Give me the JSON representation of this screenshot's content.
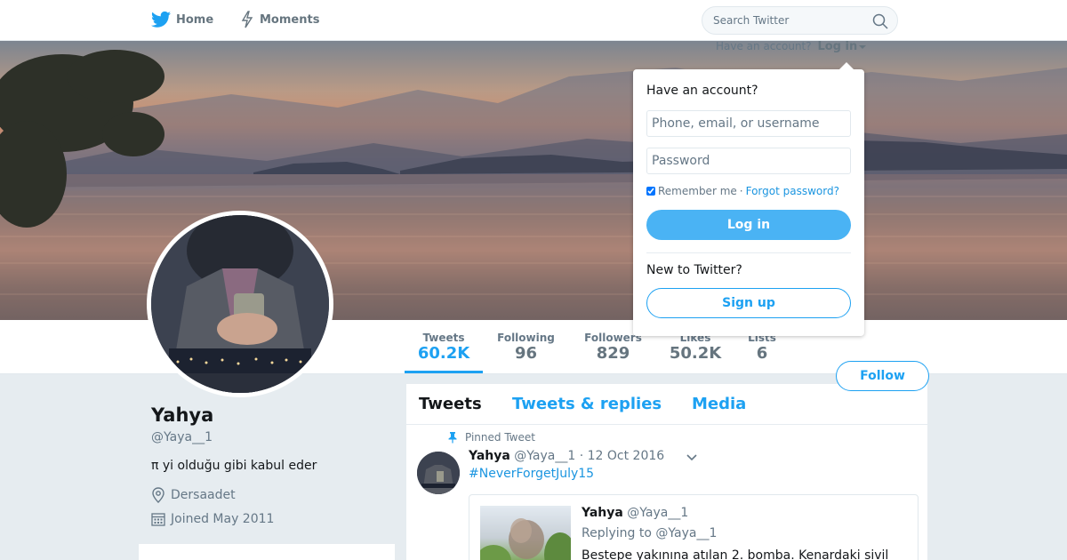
{
  "nav": {
    "home_label": "Home",
    "moments_label": "Moments",
    "search_placeholder": "Search Twitter",
    "home_icon": "twitter-bird-icon",
    "moments_icon": "lightning-icon",
    "search_icon": "magnifier-icon"
  },
  "account_prompt": {
    "text": "Have an account?",
    "login_label": "Log in"
  },
  "login_dropdown": {
    "title": "Have an account?",
    "username_placeholder": "Phone, email, or username",
    "password_placeholder": "Password",
    "remember_label": "Remember me",
    "separator": "·",
    "forgot_label": "Forgot password?",
    "login_button": "Log in",
    "new_label": "New to Twitter?",
    "signup_button": "Sign up"
  },
  "stats": [
    {
      "label": "Tweets",
      "value": "60.2K"
    },
    {
      "label": "Following",
      "value": "96"
    },
    {
      "label": "Followers",
      "value": "829"
    },
    {
      "label": "Likes",
      "value": "50.2K"
    },
    {
      "label": "Lists",
      "value": "6"
    }
  ],
  "follow_button": "Follow",
  "profile": {
    "name": "Yahya",
    "handle": "@Yaya__1",
    "bio": "π yi olduğu gibi kabul eder",
    "location": "Dersaadet",
    "joined": "Joined May 2011"
  },
  "timeline": {
    "tabs": [
      "Tweets",
      "Tweets & replies",
      "Media"
    ],
    "pinned_label": "Pinned Tweet",
    "tweet": {
      "name": "Yahya",
      "handle": "@Yaya__1",
      "date": "· 12 Oct 2016",
      "text": "#NeverForgetJuly15",
      "quote": {
        "name": "Yahya",
        "handle": "@Yaya__1",
        "reply": "Replying to @Yaya__1",
        "text": "Bestepe yakınına atılan 2. bomba. Kenardaki sivil"
      }
    }
  },
  "colors": {
    "accent": "#1da1f2",
    "background": "#e6ecf0",
    "muted": "#657786"
  }
}
